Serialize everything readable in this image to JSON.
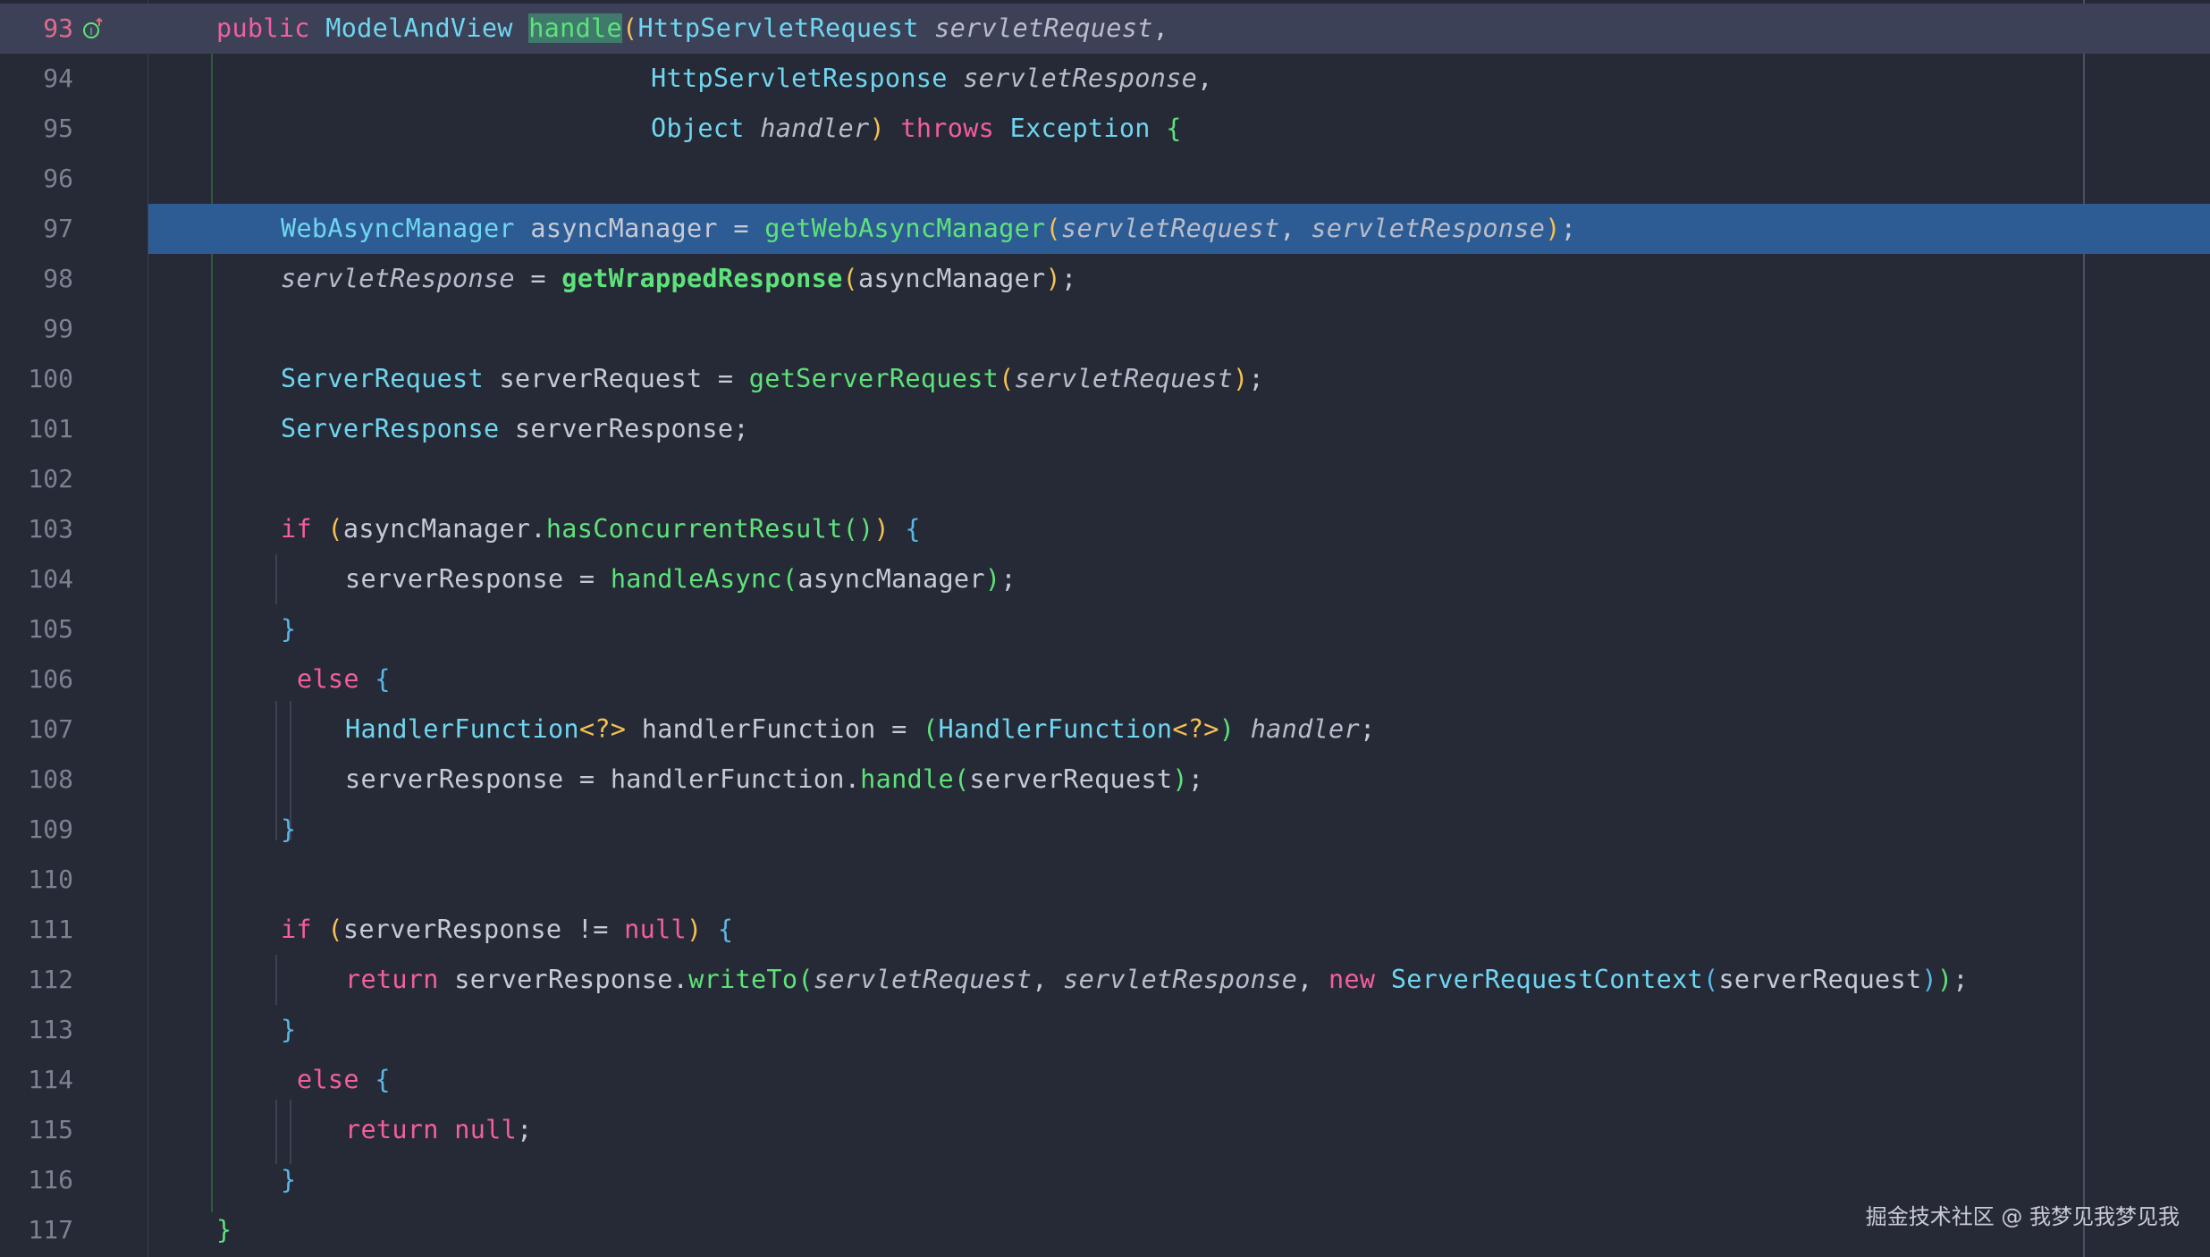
{
  "editor": {
    "lines": [
      {
        "n": "93"
      },
      {
        "n": "94"
      },
      {
        "n": "95"
      },
      {
        "n": "96"
      },
      {
        "n": "97"
      },
      {
        "n": "98"
      },
      {
        "n": "99"
      },
      {
        "n": "100"
      },
      {
        "n": "101"
      },
      {
        "n": "102"
      },
      {
        "n": "103"
      },
      {
        "n": "104"
      },
      {
        "n": "105"
      },
      {
        "n": "106"
      },
      {
        "n": "107"
      },
      {
        "n": "108"
      },
      {
        "n": "109"
      },
      {
        "n": "110"
      },
      {
        "n": "111"
      },
      {
        "n": "112"
      },
      {
        "n": "113"
      },
      {
        "n": "114"
      },
      {
        "n": "115"
      },
      {
        "n": "116"
      },
      {
        "n": "117"
      }
    ],
    "current_line": "93",
    "selected_line": "97",
    "gutter_icon": "implementation-up-icon"
  },
  "tokens": {
    "public": "public",
    "ModelAndView": "ModelAndView",
    "handle": "handle",
    "HttpServletRequest": "HttpServletRequest",
    "servletRequest": "servletRequest",
    "HttpServletResponse": "HttpServletResponse",
    "servletResponse": "servletResponse",
    "Object": "Object",
    "handler": "handler",
    "throws": "throws",
    "Exception": "Exception",
    "WebAsyncManager": "WebAsyncManager",
    "asyncManager": "asyncManager",
    "getWebAsyncManager": "getWebAsyncManager",
    "getWrappedResponse": "getWrappedResponse",
    "ServerRequest": "ServerRequest",
    "serverRequest": "serverRequest",
    "getServerRequest": "getServerRequest",
    "ServerResponse": "ServerResponse",
    "serverResponse": "serverResponse",
    "if": "if",
    "hasConcurrentResult": "hasConcurrentResult",
    "handleAsync": "handleAsync",
    "else": "else",
    "HandlerFunction": "HandlerFunction",
    "generic": "<?>",
    "handlerFunction": "handlerFunction",
    "null": "null",
    "return": "return",
    "writeTo": "writeTo",
    "new": "new",
    "ServerRequestContext": "ServerRequestContext"
  },
  "watermark": "掘金技术社区 @ 我梦见我梦见我",
  "colors": {
    "background": "#262a36",
    "current_line": "#3c4158",
    "selection": "#2d5c94",
    "keyword": "#f25ea0",
    "type": "#6fd6f0",
    "function": "#5ee27a"
  }
}
